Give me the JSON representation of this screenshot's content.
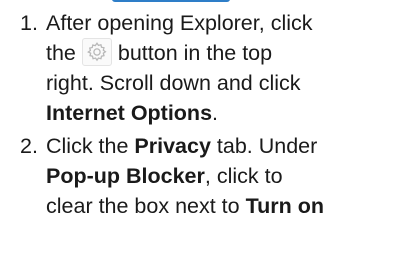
{
  "steps": [
    {
      "number": "1.",
      "line1": "After opening Explorer, click",
      "line2_before": "the",
      "line2_after": "button in the top",
      "line3": "right. Scroll down and click",
      "line4_bold": "Internet Options",
      "line4_tail": "."
    },
    {
      "number": "2.",
      "line1_before": "Click the ",
      "line1_bold": "Privacy",
      "line1_after": " tab. Under",
      "line2_bold": "Pop-up Blocker",
      "line2_after": ", click to",
      "line3_before": "clear the box next to ",
      "line3_bold": "Turn on"
    }
  ],
  "icons": {
    "settings": "gear-icon"
  },
  "colors": {
    "accent_line": "#2e7ec8",
    "text": "#1a1a1a",
    "gear": "#b8b8b8"
  }
}
